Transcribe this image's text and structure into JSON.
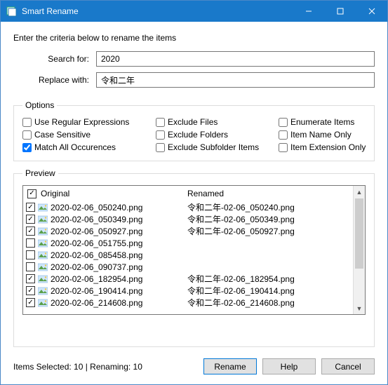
{
  "title": "Smart Rename",
  "intro": "Enter the criteria below to rename the items",
  "form": {
    "search_label": "Search for:",
    "search_value": "2020",
    "replace_label": "Replace with:",
    "replace_value": "令和二年"
  },
  "options": {
    "legend": "Options",
    "use_regex": "Use Regular Expressions",
    "case_sensitive": "Case Sensitive",
    "match_all": "Match All Occurences",
    "exclude_files": "Exclude Files",
    "exclude_folders": "Exclude Folders",
    "exclude_subfolder": "Exclude Subfolder Items",
    "enumerate": "Enumerate Items",
    "name_only": "Item Name Only",
    "ext_only": "Item Extension Only",
    "checked": {
      "use_regex": false,
      "case_sensitive": false,
      "match_all": true,
      "exclude_files": false,
      "exclude_folders": false,
      "exclude_subfolder": false,
      "enumerate": false,
      "name_only": false,
      "ext_only": false
    }
  },
  "preview": {
    "legend": "Preview",
    "header_original": "Original",
    "header_renamed": "Renamed",
    "header_checked": true,
    "rows": [
      {
        "checked": true,
        "original": "2020-02-06_050240.png",
        "renamed": "令和二年-02-06_050240.png"
      },
      {
        "checked": true,
        "original": "2020-02-06_050349.png",
        "renamed": "令和二年-02-06_050349.png"
      },
      {
        "checked": true,
        "original": "2020-02-06_050927.png",
        "renamed": "令和二年-02-06_050927.png"
      },
      {
        "checked": false,
        "original": "2020-02-06_051755.png",
        "renamed": ""
      },
      {
        "checked": false,
        "original": "2020-02-06_085458.png",
        "renamed": ""
      },
      {
        "checked": false,
        "original": "2020-02-06_090737.png",
        "renamed": ""
      },
      {
        "checked": true,
        "original": "2020-02-06_182954.png",
        "renamed": "令和二年-02-06_182954.png"
      },
      {
        "checked": true,
        "original": "2020-02-06_190414.png",
        "renamed": "令和二年-02-06_190414.png"
      },
      {
        "checked": true,
        "original": "2020-02-06_214608.png",
        "renamed": "令和二年-02-06_214608.png"
      }
    ]
  },
  "footer": {
    "status": "Items Selected: 10 | Renaming: 10",
    "rename": "Rename",
    "help": "Help",
    "cancel": "Cancel"
  }
}
